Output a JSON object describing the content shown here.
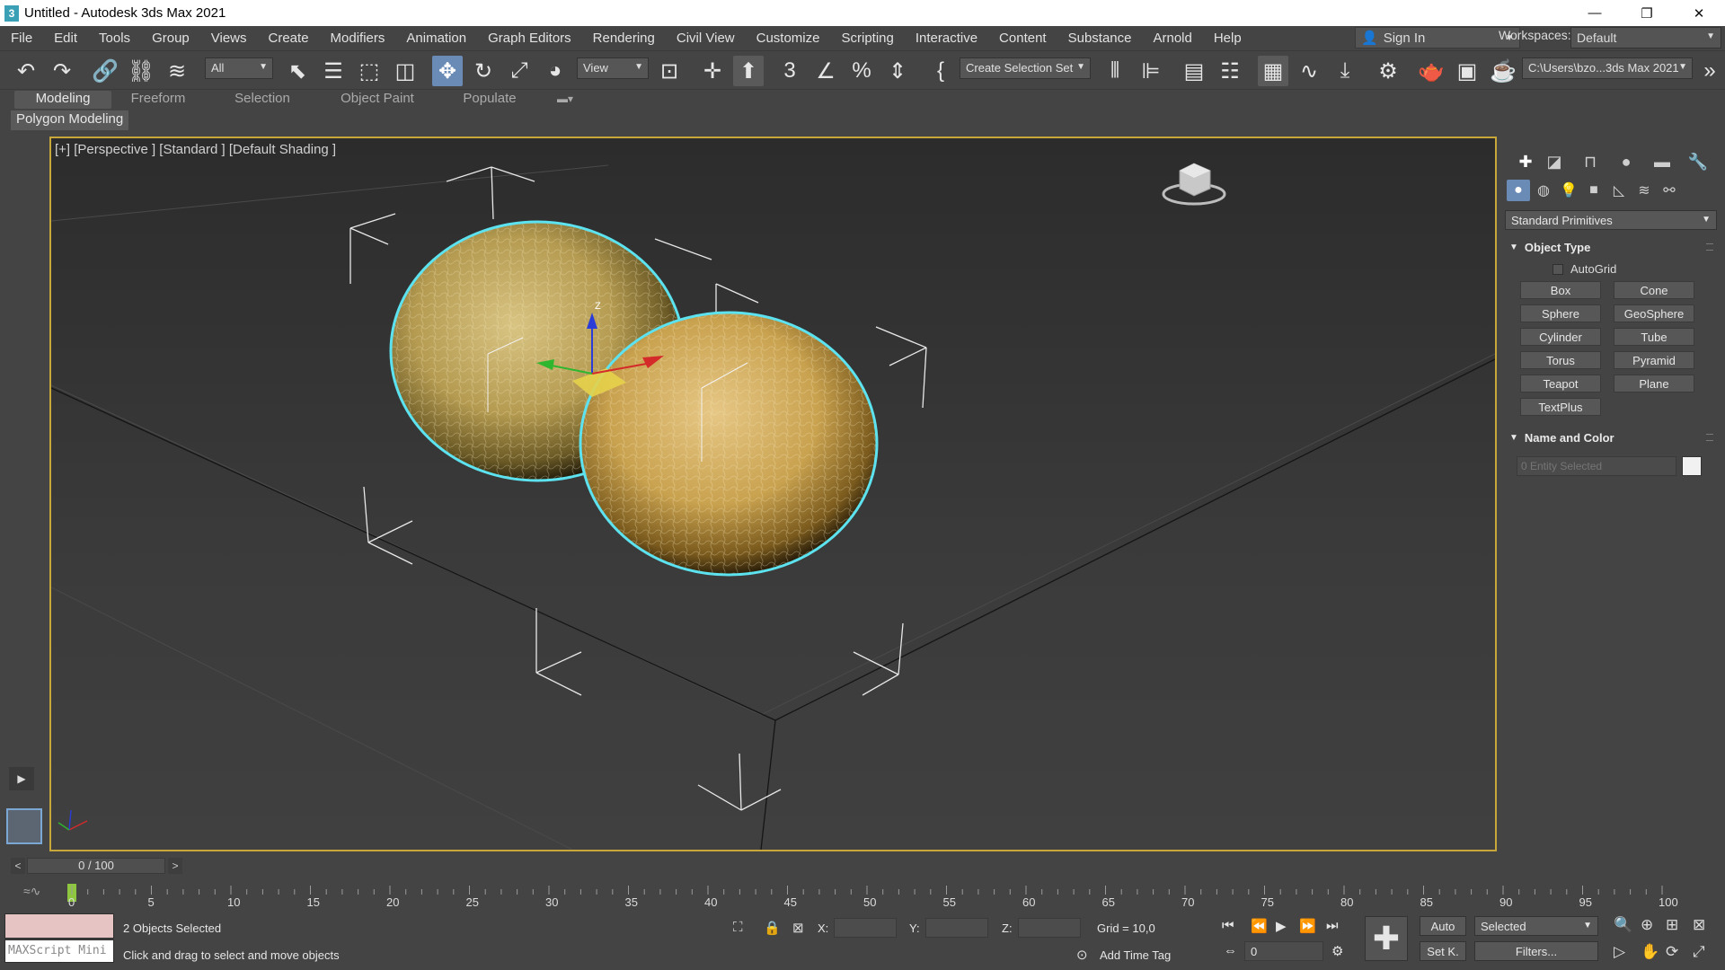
{
  "window": {
    "title": "Untitled - Autodesk 3ds Max 2021",
    "app_icon": "3",
    "minimize": "—",
    "maximize": "❐",
    "close": "✕"
  },
  "menu": {
    "items": [
      "File",
      "Edit",
      "Tools",
      "Group",
      "Views",
      "Create",
      "Modifiers",
      "Animation",
      "Graph Editors",
      "Rendering",
      "Civil View",
      "Customize",
      "Scripting",
      "Interactive",
      "Content",
      "Substance",
      "Arnold",
      "Help"
    ],
    "sign_in": "Sign In",
    "workspaces_label": "Workspaces:",
    "workspace_value": "Default"
  },
  "toolbar": {
    "selection_filter": "All",
    "ref_coord": "View",
    "named_selection": "Create Selection Set",
    "project_path": "C:\\Users\\bzo...3ds Max 2021"
  },
  "ribbon": {
    "tabs": [
      "Modeling",
      "Freeform",
      "Selection",
      "Object Paint",
      "Populate"
    ],
    "sub_label": "Polygon Modeling"
  },
  "viewport": {
    "label": "[+] [Perspective ] [Standard ] [Default Shading ]",
    "axis_z": "Z",
    "selection_color": "#5de2ef",
    "active_border": "#c7a63a"
  },
  "command_panel": {
    "dropdown": "Standard Primitives",
    "object_type_title": "Object Type",
    "autogrid": "AutoGrid",
    "buttons": [
      "Box",
      "Cone",
      "Sphere",
      "GeoSphere",
      "Cylinder",
      "Tube",
      "Torus",
      "Pyramid",
      "Teapot",
      "Plane",
      "TextPlus"
    ],
    "name_color_title": "Name and Color",
    "entity_placeholder": "0 Entity Selected",
    "object_color": "#f1f1f1"
  },
  "timeline": {
    "frame_range": "0 / 100",
    "ticks": [
      "0",
      "5",
      "10",
      "15",
      "20",
      "25",
      "30",
      "35",
      "40",
      "45",
      "50",
      "55",
      "60",
      "65",
      "70",
      "75",
      "80",
      "85",
      "90",
      "95",
      "100"
    ]
  },
  "status": {
    "listener_label": "MAXScript Mini",
    "selection_text": "2 Objects Selected",
    "prompt": "Click and drag to select and move objects",
    "x_label": "X:",
    "y_label": "Y:",
    "z_label": "Z:",
    "grid": "Grid = 10,0",
    "add_time_tag": "Add Time Tag",
    "current_frame": "0",
    "auto_key": "Auto",
    "set_key": "Set K.",
    "key_filter": "Selected",
    "filters": "Filters..."
  }
}
